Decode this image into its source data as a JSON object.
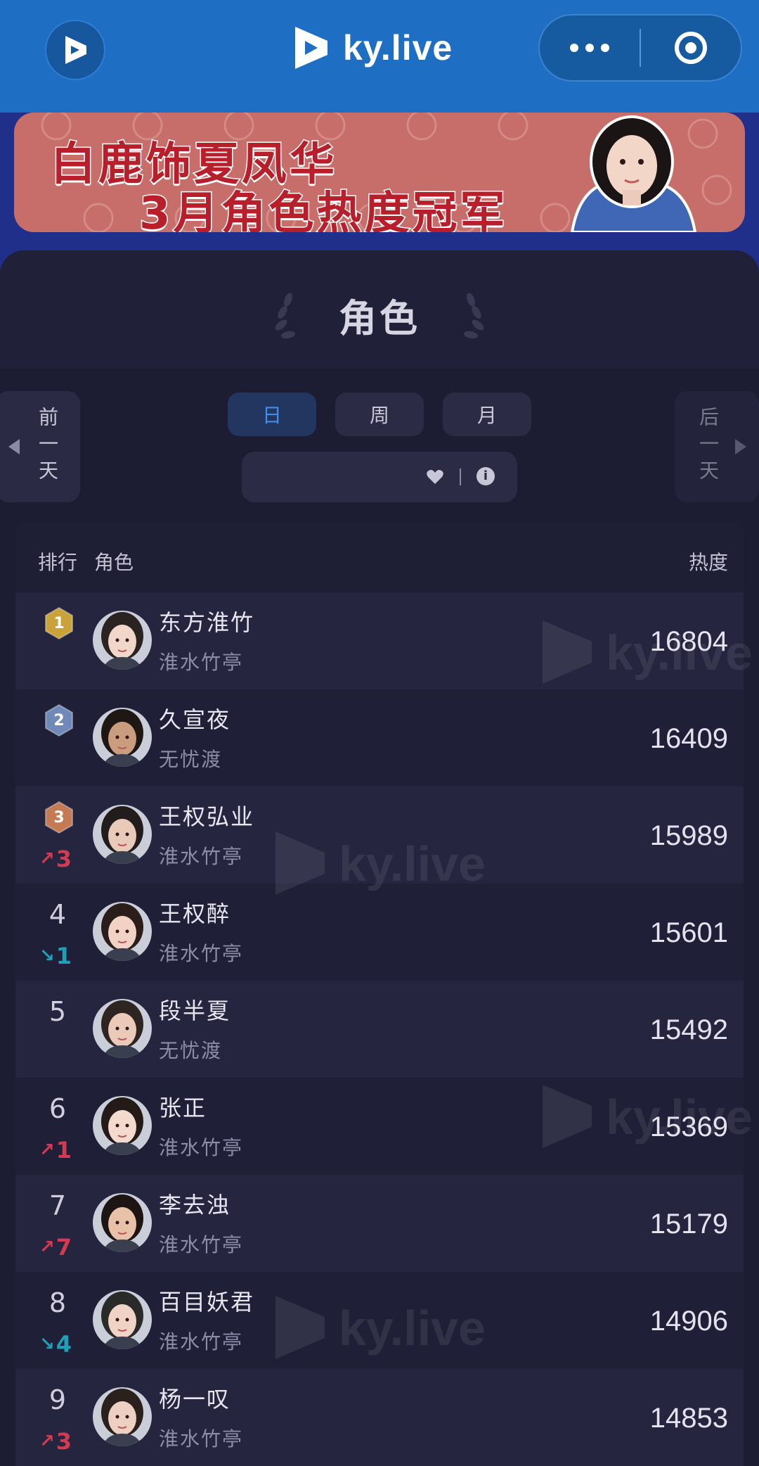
{
  "header": {
    "brand": "ky.live",
    "more_icon": "more-dots-icon",
    "close_icon": "target-ring-icon",
    "colors": {
      "topbar": "#1e6fc3",
      "capsule": "#165a9f"
    }
  },
  "banner": {
    "line1": "白鹿饰夏凤华",
    "line2": "3月角色热度冠军",
    "colors": {
      "background": "#c86e6a",
      "text": "#b81f2a"
    }
  },
  "panel": {
    "title": "角色",
    "prev": "前一天",
    "next": "后一天",
    "tabs": [
      "日",
      "周",
      "月"
    ],
    "active_tab": "日"
  },
  "table": {
    "headers": {
      "rank": "排行",
      "role": "角色",
      "heat": "热度"
    },
    "rows": [
      {
        "rank": "1",
        "name": "东方淮竹",
        "drama": "淮水竹亭",
        "score": "16804",
        "trend": "",
        "change": ""
      },
      {
        "rank": "2",
        "name": "久宣夜",
        "drama": "无忧渡",
        "score": "16409",
        "trend": "",
        "change": ""
      },
      {
        "rank": "3",
        "name": "王权弘业",
        "drama": "淮水竹亭",
        "score": "15989",
        "trend": "up",
        "change": "3"
      },
      {
        "rank": "4",
        "name": "王权醉",
        "drama": "淮水竹亭",
        "score": "15601",
        "trend": "down",
        "change": "1"
      },
      {
        "rank": "5",
        "name": "段半夏",
        "drama": "无忧渡",
        "score": "15492",
        "trend": "",
        "change": ""
      },
      {
        "rank": "6",
        "name": "张正",
        "drama": "淮水竹亭",
        "score": "15369",
        "trend": "up",
        "change": "1"
      },
      {
        "rank": "7",
        "name": "李去浊",
        "drama": "淮水竹亭",
        "score": "15179",
        "trend": "up",
        "change": "7"
      },
      {
        "rank": "8",
        "name": "百目妖君",
        "drama": "淮水竹亭",
        "score": "14906",
        "trend": "down",
        "change": "4"
      },
      {
        "rank": "9",
        "name": "杨一叹",
        "drama": "淮水竹亭",
        "score": "14853",
        "trend": "up",
        "change": "3"
      }
    ],
    "medal_colors": [
      "#c9a23a",
      "#6f89b8",
      "#c47a52"
    ]
  }
}
